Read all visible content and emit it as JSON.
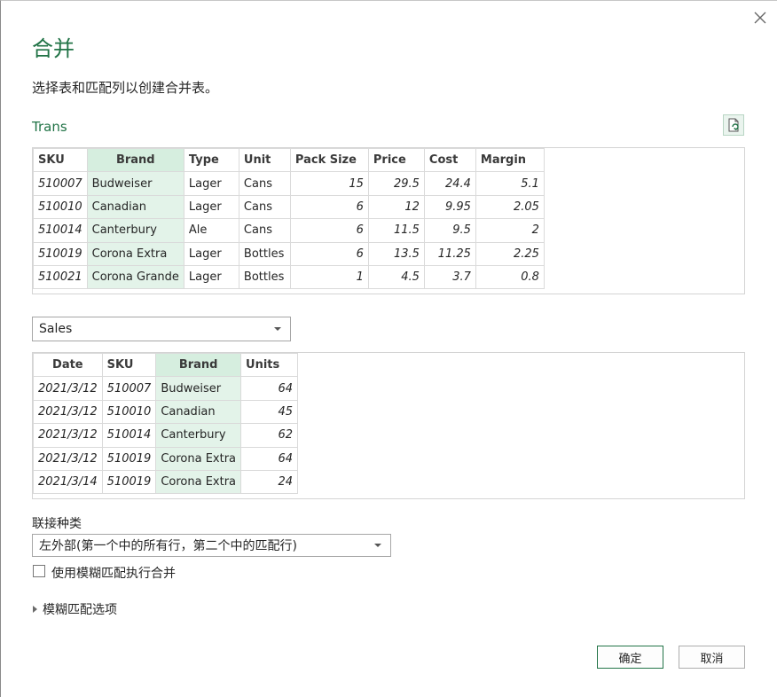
{
  "dialog": {
    "title": "合并",
    "subtitle": "选择表和匹配列以创建合并表。"
  },
  "icons": {
    "close": "close-icon",
    "refresh": "refresh-file-icon",
    "dropdown": "chevron-down-icon",
    "expand": "expand-triangle-icon"
  },
  "colors": {
    "accent": "#217346",
    "selected_header": "#d6eedf",
    "selected_cell": "#e3f3e9"
  },
  "table1": {
    "name": "Trans",
    "columns": [
      "SKU",
      "Brand",
      "Type",
      "Unit",
      "Pack Size",
      "Price",
      "Cost",
      "Margin"
    ],
    "selected_column": "Brand",
    "rows": [
      [
        "510007",
        "Budweiser",
        "Lager",
        "Cans",
        "15",
        "29.5",
        "24.4",
        "5.1"
      ],
      [
        "510010",
        "Canadian",
        "Lager",
        "Cans",
        "6",
        "12",
        "9.95",
        "2.05"
      ],
      [
        "510014",
        "Canterbury",
        "Ale",
        "Cans",
        "6",
        "11.5",
        "9.5",
        "2"
      ],
      [
        "510019",
        "Corona Extra",
        "Lager",
        "Bottles",
        "6",
        "13.5",
        "11.25",
        "2.25"
      ],
      [
        "510021",
        "Corona Grande",
        "Lager",
        "Bottles",
        "1",
        "4.5",
        "3.7",
        "0.8"
      ]
    ]
  },
  "table2": {
    "selected_table": "Sales",
    "columns": [
      "Date",
      "SKU",
      "Brand",
      "Units"
    ],
    "selected_column": "Brand",
    "rows": [
      [
        "2021/3/12",
        "510007",
        "Budweiser",
        "64"
      ],
      [
        "2021/3/12",
        "510010",
        "Canadian",
        "45"
      ],
      [
        "2021/3/12",
        "510014",
        "Canterbury",
        "62"
      ],
      [
        "2021/3/12",
        "510019",
        "Corona Extra",
        "64"
      ],
      [
        "2021/3/14",
        "510019",
        "Corona Extra",
        "24"
      ]
    ]
  },
  "join": {
    "label": "联接种类",
    "selected": "左外部(第一个中的所有行，第二个中的匹配行)"
  },
  "fuzzy": {
    "checkbox_label": "使用模糊匹配执行合并",
    "checked": false,
    "options_label": "模糊匹配选项"
  },
  "buttons": {
    "ok": "确定",
    "cancel": "取消"
  }
}
